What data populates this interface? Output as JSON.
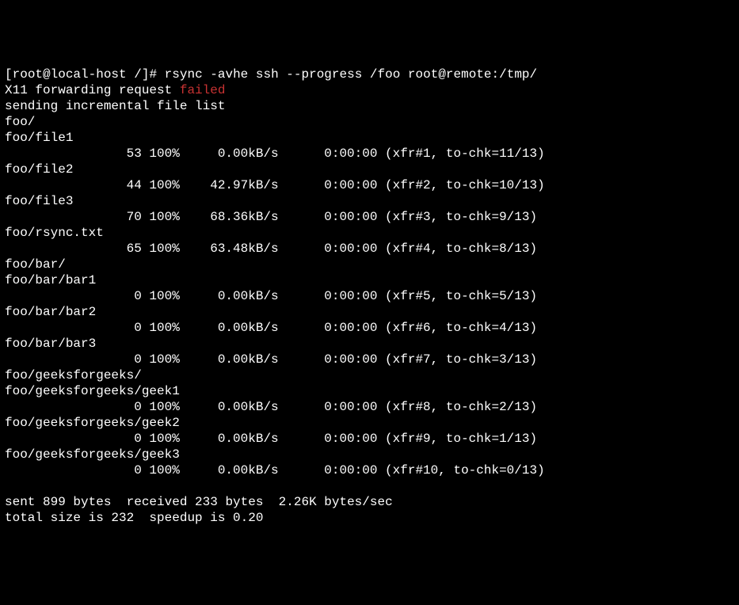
{
  "prompt": {
    "open": "[",
    "user": "root@local-host",
    "path": " /",
    "close": "]# ",
    "cmd": "rsync -avhe ssh --progress /foo root@remote:/tmp/"
  },
  "x11": {
    "prefix": "X11 forwarding request ",
    "status": "failed"
  },
  "sending": "sending incremental file list",
  "entries": [
    {
      "type": "dir",
      "name": "foo/"
    },
    {
      "type": "file",
      "name": "foo/file1",
      "size": "53",
      "pct": "100%",
      "rate": "0.00kB/s",
      "time": "0:00:00",
      "xfr": "(xfr#1, to-chk=11/13)"
    },
    {
      "type": "file",
      "name": "foo/file2",
      "size": "44",
      "pct": "100%",
      "rate": "42.97kB/s",
      "time": "0:00:00",
      "xfr": "(xfr#2, to-chk=10/13)"
    },
    {
      "type": "file",
      "name": "foo/file3",
      "size": "70",
      "pct": "100%",
      "rate": "68.36kB/s",
      "time": "0:00:00",
      "xfr": "(xfr#3, to-chk=9/13)"
    },
    {
      "type": "file",
      "name": "foo/rsync.txt",
      "size": "65",
      "pct": "100%",
      "rate": "63.48kB/s",
      "time": "0:00:00",
      "xfr": "(xfr#4, to-chk=8/13)"
    },
    {
      "type": "dir",
      "name": "foo/bar/"
    },
    {
      "type": "file",
      "name": "foo/bar/bar1",
      "size": "0",
      "pct": "100%",
      "rate": "0.00kB/s",
      "time": "0:00:00",
      "xfr": "(xfr#5, to-chk=5/13)"
    },
    {
      "type": "file",
      "name": "foo/bar/bar2",
      "size": "0",
      "pct": "100%",
      "rate": "0.00kB/s",
      "time": "0:00:00",
      "xfr": "(xfr#6, to-chk=4/13)"
    },
    {
      "type": "file",
      "name": "foo/bar/bar3",
      "size": "0",
      "pct": "100%",
      "rate": "0.00kB/s",
      "time": "0:00:00",
      "xfr": "(xfr#7, to-chk=3/13)"
    },
    {
      "type": "dir",
      "name": "foo/geeksforgeeks/"
    },
    {
      "type": "file",
      "name": "foo/geeksforgeeks/geek1",
      "size": "0",
      "pct": "100%",
      "rate": "0.00kB/s",
      "time": "0:00:00",
      "xfr": "(xfr#8, to-chk=2/13)"
    },
    {
      "type": "file",
      "name": "foo/geeksforgeeks/geek2",
      "size": "0",
      "pct": "100%",
      "rate": "0.00kB/s",
      "time": "0:00:00",
      "xfr": "(xfr#9, to-chk=1/13)"
    },
    {
      "type": "file",
      "name": "foo/geeksforgeeks/geek3",
      "size": "0",
      "pct": "100%",
      "rate": "0.00kB/s",
      "time": "0:00:00",
      "xfr": "(xfr#10, to-chk=0/13)"
    }
  ],
  "summary1": "sent 899 bytes  received 233 bytes  2.26K bytes/sec",
  "summary2": "total size is 232  speedup is 0.20"
}
